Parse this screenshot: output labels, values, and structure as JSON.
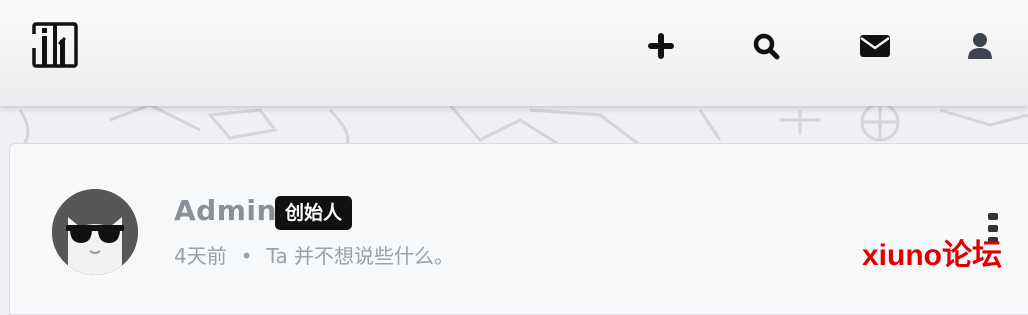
{
  "header": {
    "logo_icon": "site-logo-icon",
    "nav": [
      {
        "name": "add",
        "icon": "plus-icon"
      },
      {
        "name": "search",
        "icon": "search-icon"
      },
      {
        "name": "messages",
        "icon": "envelope-icon"
      },
      {
        "name": "account",
        "icon": "user-icon"
      }
    ]
  },
  "profile": {
    "username": "Admin",
    "role": "创始人",
    "time": "4天前",
    "separator": "•",
    "bio": "Ta 并不想说些什么。",
    "avatar_icon": "cat-sunglasses-avatar"
  },
  "watermark": "xiuno论坛",
  "colors": {
    "accent": "#111111",
    "watermark": "#e00000",
    "muted_text": "#8a8f99"
  }
}
